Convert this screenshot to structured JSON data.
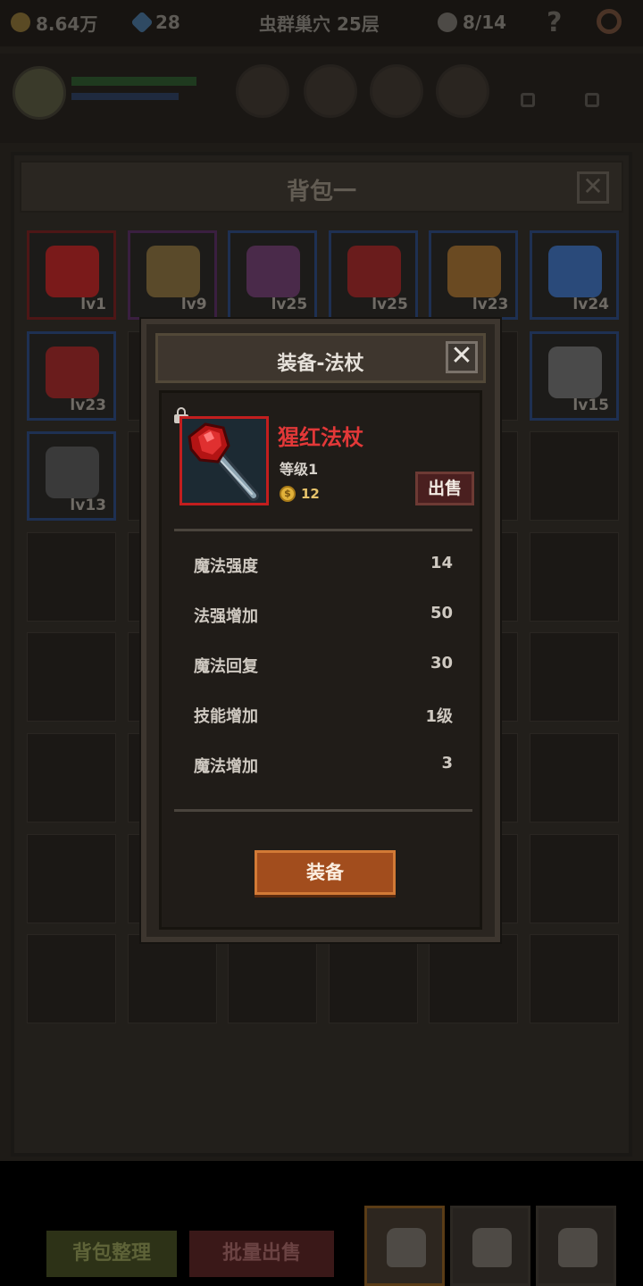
{
  "topbar": {
    "gold": "8.64万",
    "gems": "28",
    "location": "虫群巢穴 25层",
    "kills": "8/14",
    "help": "?"
  },
  "inventory": {
    "title": "背包一",
    "close": "✕",
    "items": [
      {
        "level": "lv1",
        "rarity": "red"
      },
      {
        "level": "lv9",
        "rarity": "purple"
      },
      {
        "level": "lv25",
        "rarity": "blue"
      },
      {
        "level": "lv25",
        "rarity": "blue"
      },
      {
        "level": "lv23",
        "rarity": "blue"
      },
      {
        "level": "lv24",
        "rarity": "blue"
      },
      {
        "level": "lv23",
        "rarity": "blue"
      },
      {
        "level": "lv15",
        "rarity": "blue"
      },
      {
        "level": "lv13",
        "rarity": "blue"
      }
    ],
    "sort_button": "背包整理",
    "batch_sell_button": "批量出售"
  },
  "modal": {
    "title": "装备-法杖",
    "close": "✕",
    "item_name": "猩红法杖",
    "item_level": "等级1",
    "price": "12",
    "coin_symbol": "$",
    "sell_button": "出售",
    "stats": [
      {
        "label": "魔法强度",
        "value": "14"
      },
      {
        "label": "法强增加",
        "value": "50"
      },
      {
        "label": "魔法回复",
        "value": "30"
      },
      {
        "label": "技能增加",
        "value": "1级"
      },
      {
        "label": "魔法增加",
        "value": "3"
      }
    ],
    "equip_button": "装备"
  },
  "colors": {
    "item_name": "#e23838",
    "item_frame": "#c21e1e",
    "equip_button": "#a24d1d",
    "sell_button": "#4a1f1f"
  }
}
